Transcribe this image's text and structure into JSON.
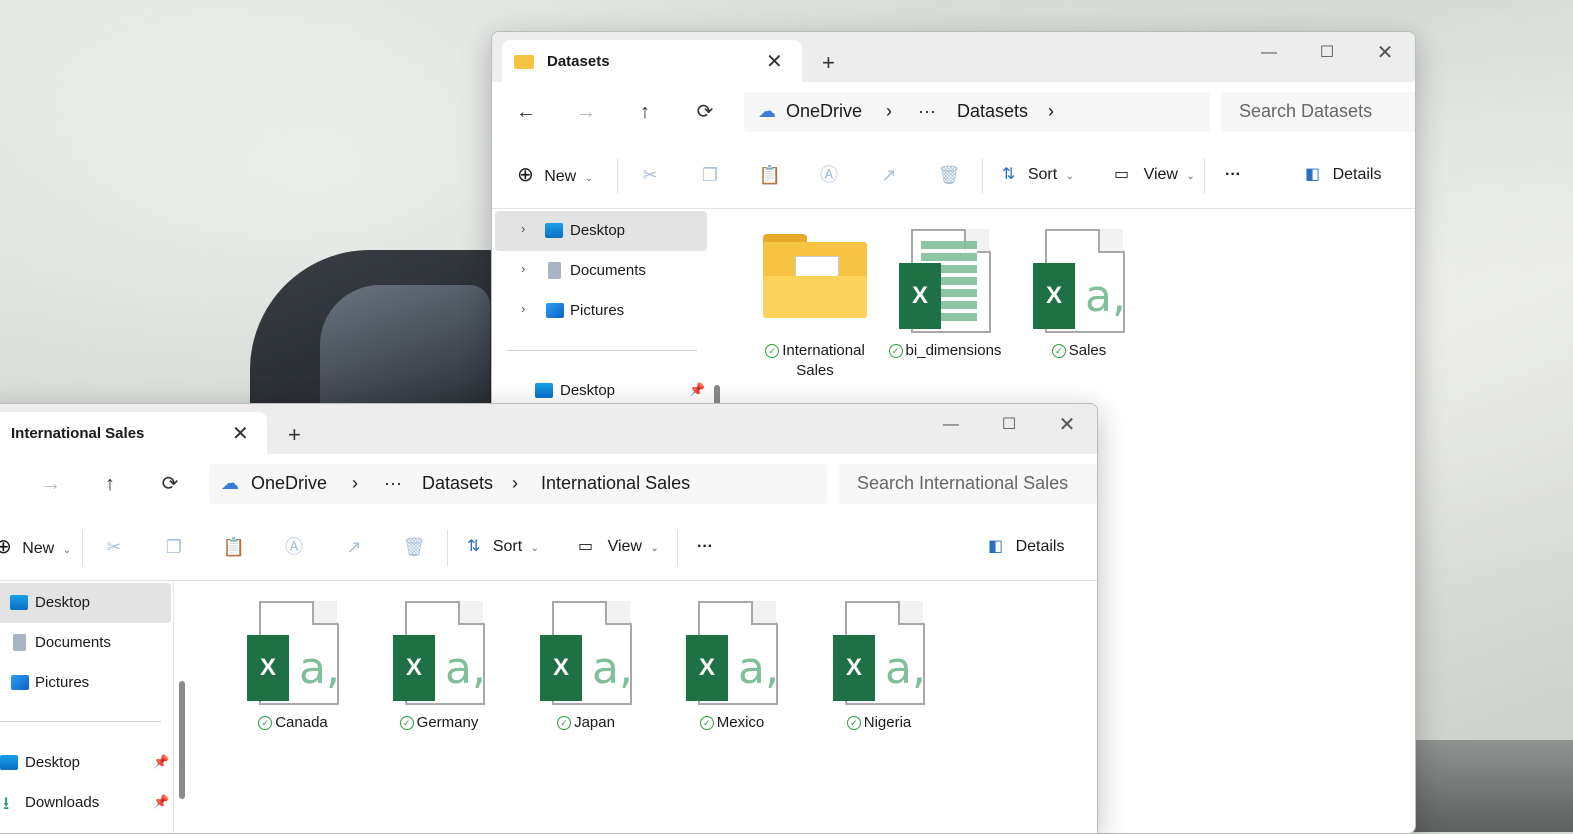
{
  "back_window": {
    "tab_title": "Datasets",
    "nav": {
      "back": "←",
      "forward": "→",
      "up": "↑",
      "refresh": "⟳"
    },
    "breadcrumb": {
      "root": "OneDrive",
      "ellipsis": "···",
      "current": "Datasets"
    },
    "search_placeholder": "Search Datasets",
    "toolbar": {
      "new": "New",
      "sort": "Sort",
      "view": "View",
      "more": "···",
      "details": "Details"
    },
    "sidebar": [
      {
        "label": "Desktop",
        "icon": "desktop-icon",
        "selected": true
      },
      {
        "label": "Documents",
        "icon": "documents-icon"
      },
      {
        "label": "Pictures",
        "icon": "pictures-icon"
      }
    ],
    "quick_access": [
      {
        "label": "Desktop",
        "icon": "desktop-icon",
        "pinned": true
      }
    ],
    "files": [
      {
        "name": "International Sales",
        "type": "folder"
      },
      {
        "name": "bi_dimensions",
        "type": "excel-table"
      },
      {
        "name": "Sales",
        "type": "excel-csv"
      }
    ]
  },
  "front_window": {
    "tab_title": "International Sales",
    "nav": {
      "forward": "→",
      "up": "↑",
      "refresh": "⟳"
    },
    "breadcrumb": {
      "root": "OneDrive",
      "ellipsis": "···",
      "parent": "Datasets",
      "current": "International Sales"
    },
    "search_placeholder": "Search International Sales",
    "toolbar": {
      "new": "New",
      "sort": "Sort",
      "view": "View",
      "more": "···",
      "details": "Details"
    },
    "sidebar": [
      {
        "label": "Desktop",
        "icon": "desktop-icon",
        "selected": true
      },
      {
        "label": "Documents",
        "icon": "documents-icon"
      },
      {
        "label": "Pictures",
        "icon": "pictures-icon"
      }
    ],
    "quick_access": [
      {
        "label": "Desktop",
        "icon": "desktop-icon",
        "pinned": true
      },
      {
        "label": "Downloads",
        "icon": "downloads-icon",
        "pinned": true
      }
    ],
    "files": [
      {
        "name": "Canada",
        "type": "excel-csv"
      },
      {
        "name": "Germany",
        "type": "excel-csv"
      },
      {
        "name": "Japan",
        "type": "excel-csv"
      },
      {
        "name": "Mexico",
        "type": "excel-csv"
      },
      {
        "name": "Nigeria",
        "type": "excel-csv"
      }
    ]
  },
  "colors": {
    "excel_green": "#1e7145",
    "sync_check": "#2e9d3e",
    "folder_yellow": "#f6c343"
  }
}
